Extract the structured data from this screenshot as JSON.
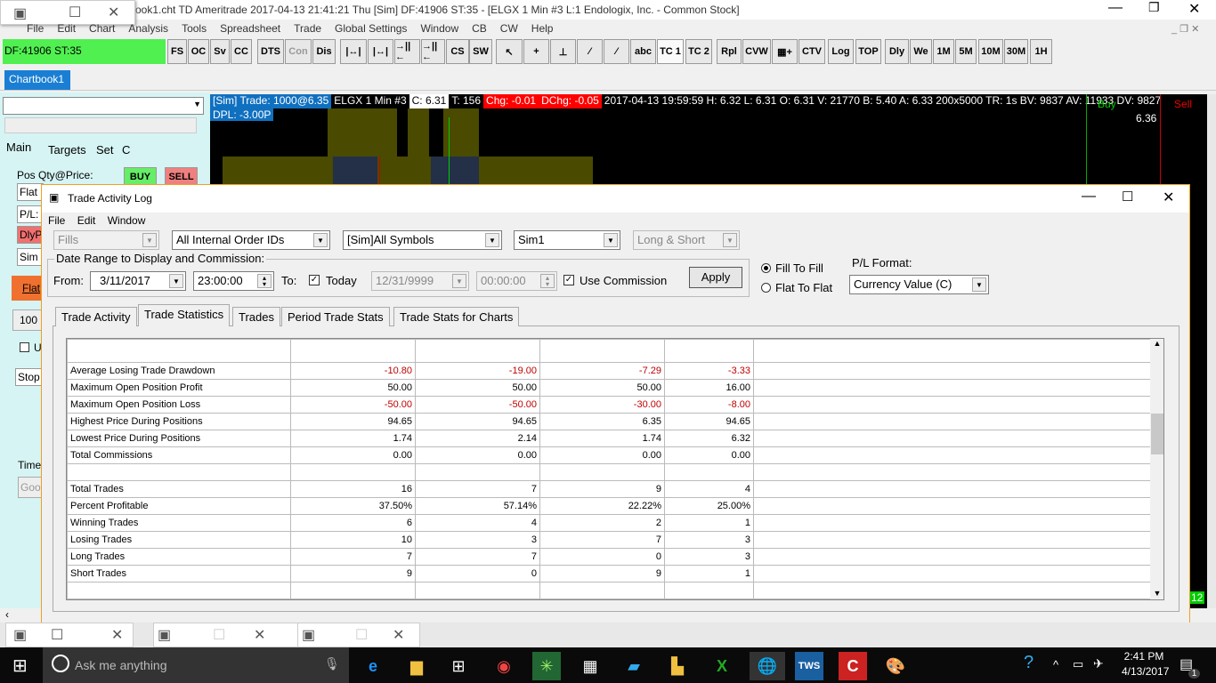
{
  "window": {
    "title": "Chartbook1.cht  TD Ameritrade 2017-04-13  21:41:21 Thu [Sim]  DF:41906  ST:35 - [ELGX  1 Min   #3  L:1  Endologix, Inc. - Common Stock]",
    "title_visible": "ook1.cht  TD Ameritrade 2017-04-13  21:41:21 Thu [Sim]  DF:41906  ST:35 - [ELGX  1 Min   #3  L:1  Endologix, Inc. - Common Stock]"
  },
  "menu": [
    "File",
    "Edit",
    "Chart",
    "Analysis",
    "Tools",
    "Spreadsheet",
    "Trade",
    "Global Settings",
    "Window",
    "CB",
    "CW",
    "Help"
  ],
  "status_box": "DF:41906  ST:35",
  "toolbar": [
    "FS",
    "OC",
    "Sv",
    "CC",
    "DTS",
    "Con",
    "Dis",
    "|↔|",
    "|↔|",
    "→||←",
    "→||←",
    "CS",
    "SW",
    "↖",
    "+",
    "⊥",
    "⁄",
    "⁄",
    "abc",
    "TC 1",
    "TC 2",
    "Rpl",
    "CVW",
    "▦+",
    "CTV",
    "Log",
    "TOP",
    "Dly",
    "We",
    "1M",
    "5M",
    "10M",
    "30M",
    "1H"
  ],
  "chartbook_tab": "Chartbook1",
  "chart": {
    "info": [
      {
        "t": "[Sim]  Trade: 1000@6.35",
        "c": "#1070c0"
      },
      {
        "t": "ELGX  1 Min   #3",
        "c": "#000"
      },
      {
        "t": "C: 6.31",
        "c": "#fff"
      },
      {
        "t": "T: 156",
        "c": "#000"
      },
      {
        "t": "Chg: -0.01",
        "c": "#ff0000"
      },
      {
        "t": "DChg: -0.05",
        "c": "#ff0000"
      },
      {
        "t": "2017-04-13 19:59:59 H: 6.32 L: 6.31 O: 6.31 V: 21770 B: 5.40 A: 6.33 200x5000 TR: 1s BV: 9837 AV: 11933 DV: 9827",
        "c": "#000"
      }
    ],
    "dpl": "DPL: -3.00P",
    "buy": "Buy",
    "sell": "Sell",
    "price": "6.36",
    "corner": "12"
  },
  "left_panel": {
    "tabs": [
      "Main",
      "Targets",
      "Set",
      "C"
    ],
    "pos_label": "Pos Qty@Price:",
    "buy": "BUY",
    "sell": "SELL",
    "flat": "Flat",
    "pl": "P/L:",
    "dly": "DlyP",
    "sim": "Sim",
    "flat_btn": "Flat",
    "qty": "100",
    "u": "U",
    "stop": "Stop",
    "time": "Time",
    "goo": "Goo"
  },
  "dialog": {
    "title": "Trade Activity Log",
    "menu": [
      "File",
      "Edit",
      "Window"
    ],
    "fills": "Fills",
    "order_ids": "All Internal Order IDs",
    "symbols": "[Sim]All Symbols",
    "account": "Sim1",
    "side": "Long & Short",
    "group_label": "Date Range to Display and Commission:",
    "from_label": "From:",
    "from_date": "3/11/2017",
    "from_time": "23:00:00",
    "to_label": "To:",
    "today_label": "Today",
    "today_checked": true,
    "to_date": "12/31/9999",
    "to_time": "00:00:00",
    "use_commission": "Use Commission",
    "use_commission_checked": true,
    "apply": "Apply",
    "fill_to_fill": "Fill To Fill",
    "flat_to_flat": "Flat To Flat",
    "fill_mode": "Fill To Fill",
    "pl_format_label": "P/L Format:",
    "pl_format": "Currency Value (C)",
    "tabs": [
      "Trade Activity",
      "Trade Statistics",
      "Trades",
      "Period Trade Stats",
      "Trade Stats for Charts"
    ],
    "active_tab": "Trade Statistics",
    "rows": [
      {
        "label": "Average Losing Trade Drawdown",
        "v": [
          "-10.80",
          "-19.00",
          "-7.29",
          "-3.33"
        ],
        "neg": true
      },
      {
        "label": "Maximum Open Position Profit",
        "v": [
          "50.00",
          "50.00",
          "50.00",
          "16.00"
        ]
      },
      {
        "label": "Maximum Open Position Loss",
        "v": [
          "-50.00",
          "-50.00",
          "-30.00",
          "-8.00"
        ],
        "neg": true
      },
      {
        "label": "Highest Price During Positions",
        "v": [
          "94.65",
          "94.65",
          "6.35",
          "94.65"
        ]
      },
      {
        "label": "Lowest Price During Positions",
        "v": [
          "1.74",
          "2.14",
          "1.74",
          "6.32"
        ]
      },
      {
        "label": "Total Commissions",
        "v": [
          "0.00",
          "0.00",
          "0.00",
          "0.00"
        ]
      },
      {
        "label": "",
        "v": [
          "",
          "",
          "",
          ""
        ]
      },
      {
        "label": "Total Trades",
        "v": [
          "16",
          "7",
          "9",
          "4"
        ]
      },
      {
        "label": "Percent Profitable",
        "v": [
          "37.50%",
          "57.14%",
          "22.22%",
          "25.00%"
        ]
      },
      {
        "label": "Winning Trades",
        "v": [
          "6",
          "4",
          "2",
          "1"
        ]
      },
      {
        "label": "Losing Trades",
        "v": [
          "10",
          "3",
          "7",
          "3"
        ]
      },
      {
        "label": "Long Trades",
        "v": [
          "7",
          "7",
          "0",
          "3"
        ]
      },
      {
        "label": "Short Trades",
        "v": [
          "9",
          "0",
          "9",
          "1"
        ]
      },
      {
        "label": "",
        "v": [
          "",
          "",
          "",
          ""
        ]
      }
    ]
  },
  "taskbar": {
    "search": "Ask me anything",
    "time": "2:41 PM",
    "date": "4/13/2017",
    "notif": "1"
  }
}
